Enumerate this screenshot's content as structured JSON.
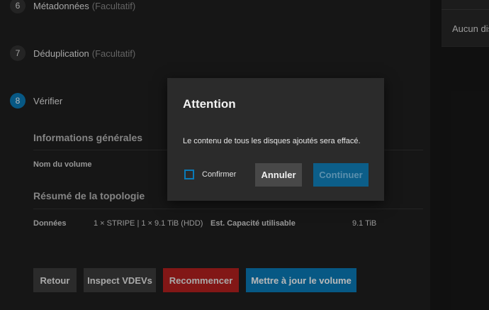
{
  "steps": [
    {
      "num": "6",
      "title": "Métadonnées",
      "optional": "(Facultatif)"
    },
    {
      "num": "7",
      "title": "Déduplication",
      "optional": "(Facultatif)"
    },
    {
      "num": "8",
      "title": "Vérifier",
      "optional": ""
    }
  ],
  "review": {
    "general_heading": "Informations générales",
    "volume_name_label": "Nom du volume",
    "topology_heading": "Résumé de la topologie",
    "data_label": "Données",
    "data_value": "1 × STRIPE | 1 × 9.1 TiB (HDD)",
    "capacity_label": "Est. Capacité utilisable",
    "capacity_value": "9.1 TiB"
  },
  "footer_buttons": {
    "back": "Retour",
    "inspect": "Inspect VDEVs",
    "restart": "Recommencer",
    "update": "Mettre à jour le volume"
  },
  "right_panel": {
    "text": "Aucun dis"
  },
  "dialog": {
    "title": "Attention",
    "message": "Le contenu de tous les disques ajoutés sera effacé.",
    "confirm_label": "Confirmer",
    "confirm_checked": false,
    "cancel": "Annuler",
    "continue": "Continuer"
  },
  "colors": {
    "accent": "#0a7ab8",
    "danger": "#b5201f"
  }
}
